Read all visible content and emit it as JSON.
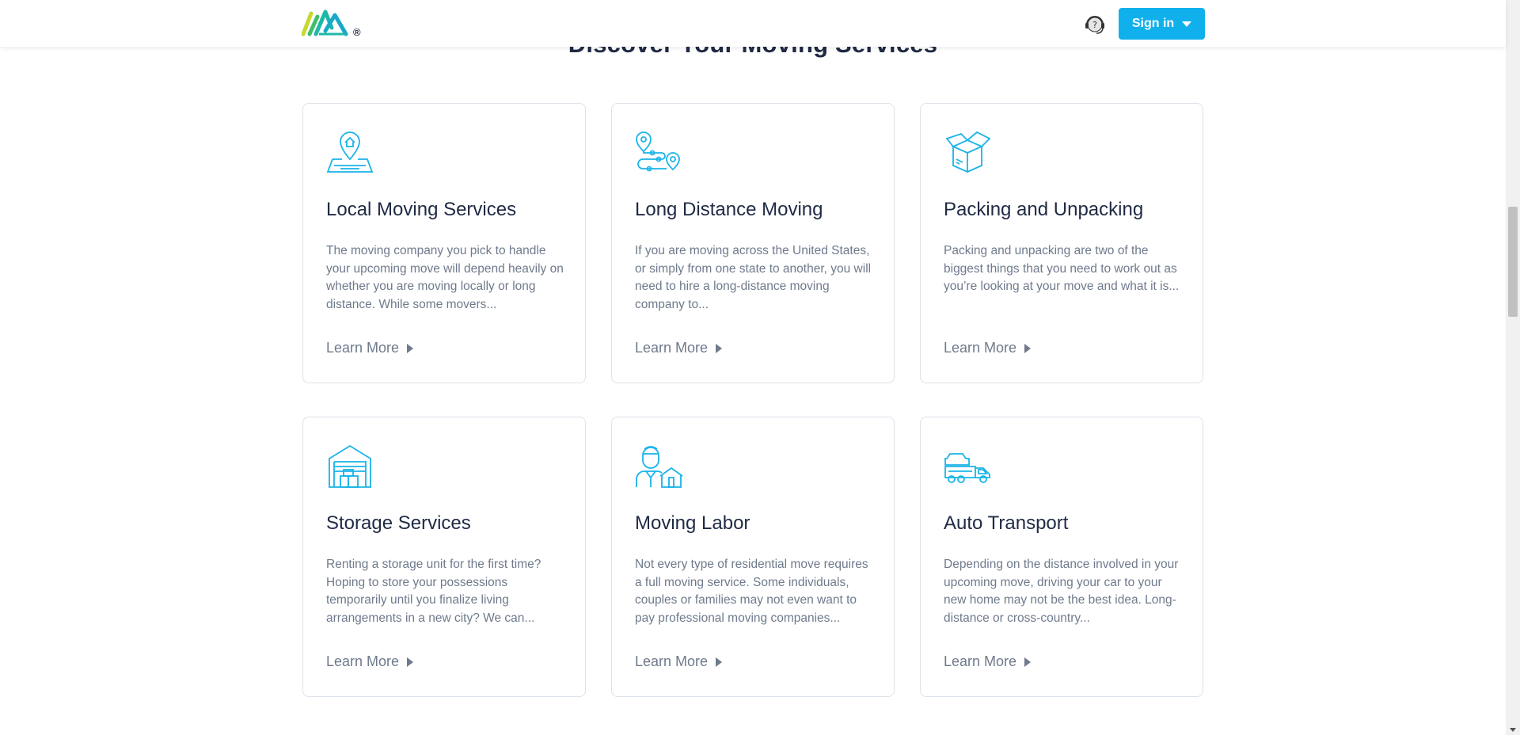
{
  "header": {
    "logo_mark": "®",
    "help_label": "?",
    "signin_label": "Sign in",
    "accent": "#10b0ec"
  },
  "section": {
    "title": "Discover Your Moving Services"
  },
  "cards": [
    {
      "icon": "map-pin-house-icon",
      "title": "Local Moving Services",
      "description": "The moving company you pick to handle your upcoming move will depend heavily on whether you are moving locally or long distance. While some movers...",
      "link": "Learn More"
    },
    {
      "icon": "route-pins-icon",
      "title": "Long Distance Moving",
      "description": "If you are moving across the United States, or simply from one state to another, you will need to hire a long-distance moving company to...",
      "link": "Learn More"
    },
    {
      "icon": "open-box-icon",
      "title": "Packing and Unpacking",
      "description": "Packing and unpacking are two of the biggest things that you need to work out as you’re looking at your move and what it is...",
      "link": "Learn More"
    },
    {
      "icon": "storage-unit-icon",
      "title": "Storage Services",
      "description": "Renting a storage unit for the first time? Hoping to store your possessions temporarily until you finalize living arrangements in a new city? We can...",
      "link": "Learn More"
    },
    {
      "icon": "mover-person-icon",
      "title": "Moving Labor",
      "description": "Not every type of residential move requires a full moving service. Some individuals, couples or families may not even want to pay professional moving companies...",
      "link": "Learn More"
    },
    {
      "icon": "car-transport-icon",
      "title": "Auto Transport",
      "description": "Depending on the distance involved in your upcoming move, driving your car to your new home may not be the best idea. Long-distance or cross-country...",
      "link": "Learn More"
    }
  ]
}
